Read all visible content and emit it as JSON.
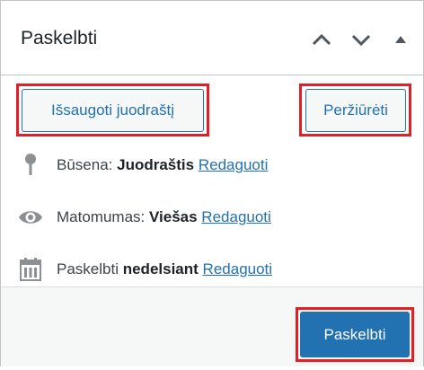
{
  "panel": {
    "title": "Paskelbti",
    "controls": [
      "chevron-up-icon",
      "chevron-down-icon",
      "triangle-up-icon"
    ]
  },
  "actions": {
    "save_draft_label": "Išsaugoti juodraštį",
    "preview_label": "Peržiūrėti"
  },
  "status": {
    "label": "Būsena:",
    "value": "Juodraštis",
    "edit_link": "Redaguoti"
  },
  "visibility": {
    "label": "Matomumas:",
    "value": "Viešas",
    "edit_link": "Redaguoti"
  },
  "schedule": {
    "label": "Paskelbti",
    "value": "nedelsiant",
    "edit_link": "Redaguoti"
  },
  "publish_label": "Paskelbti",
  "colors": {
    "accent": "#2271b1",
    "highlight": "#e31e24",
    "footer_bg": "#f6f7f7"
  }
}
